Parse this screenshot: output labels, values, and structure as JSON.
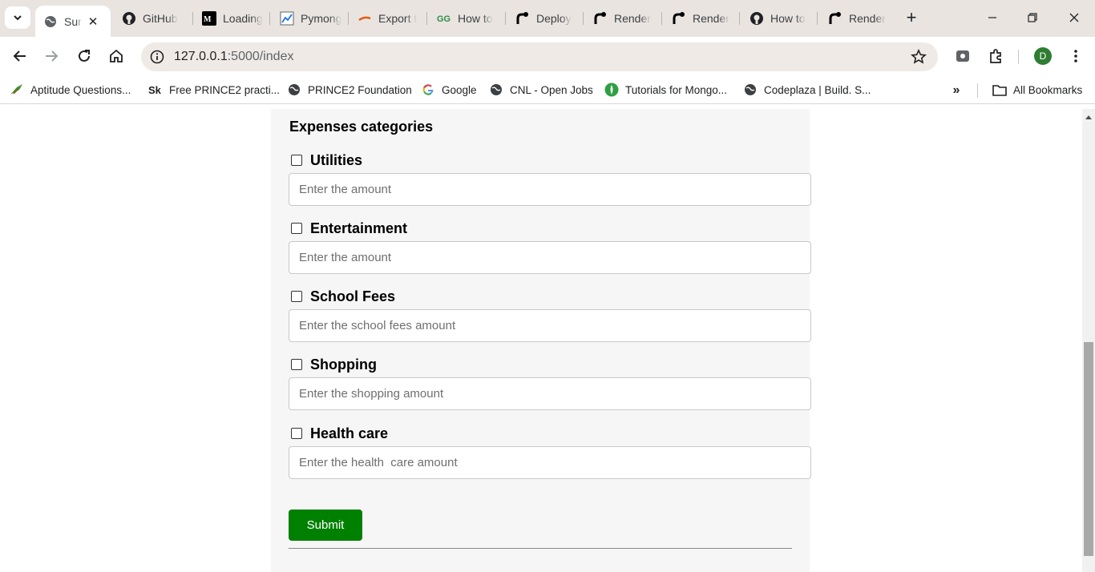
{
  "browser": {
    "tabs": [
      {
        "title": "Sur",
        "icon": "globe-icon",
        "active": true
      },
      {
        "title": "GitHub",
        "icon": "github-icon"
      },
      {
        "title": "Loading",
        "icon": "medium-icon"
      },
      {
        "title": "Pymong",
        "icon": "chart-line-icon"
      },
      {
        "title": "Export t",
        "icon": "swoosh-icon"
      },
      {
        "title": "How to",
        "icon": "gfg-icon"
      },
      {
        "title": "Deploy",
        "icon": "render-icon"
      },
      {
        "title": "Render",
        "icon": "render-icon"
      },
      {
        "title": "Render",
        "icon": "render-icon"
      },
      {
        "title": "How to",
        "icon": "github-icon"
      },
      {
        "title": "Render",
        "icon": "render-icon"
      }
    ],
    "url_host": "127.0.0.1",
    "url_path": ":5000/index",
    "profile_initial": "D",
    "bookmarks": [
      {
        "label": "Aptitude Questions...",
        "icon": "bird-icon"
      },
      {
        "label": "Free PRINCE2 practi...",
        "icon": "sk-icon"
      },
      {
        "label": "PRINCE2 Foundation",
        "icon": "globe-icon"
      },
      {
        "label": "Google",
        "icon": "google-icon"
      },
      {
        "label": "CNL - Open Jobs",
        "icon": "globe-icon"
      },
      {
        "label": "Tutorials for Mongo...",
        "icon": "leaf-icon"
      },
      {
        "label": "Codeplaza | Build. S...",
        "icon": "globe-icon"
      }
    ],
    "all_bookmarks_label": "All Bookmarks",
    "more_bookmarks_glyph": "»"
  },
  "form": {
    "heading": "Expenses categories",
    "categories": [
      {
        "label": "Utilities",
        "placeholder": "Enter the amount"
      },
      {
        "label": "Entertainment",
        "placeholder": "Enter the amount"
      },
      {
        "label": "School Fees",
        "placeholder": "Enter the school fees amount"
      },
      {
        "label": "Shopping",
        "placeholder": "Enter the shopping amount"
      },
      {
        "label": "Health care",
        "placeholder": "Enter the health  care amount"
      }
    ],
    "submit_label": "Submit"
  },
  "colors": {
    "submit_bg": "#008000",
    "card_bg": "#f6f6f6",
    "tabstrip_bg": "#e9e4e0",
    "profile_bg": "#2e7d32"
  }
}
